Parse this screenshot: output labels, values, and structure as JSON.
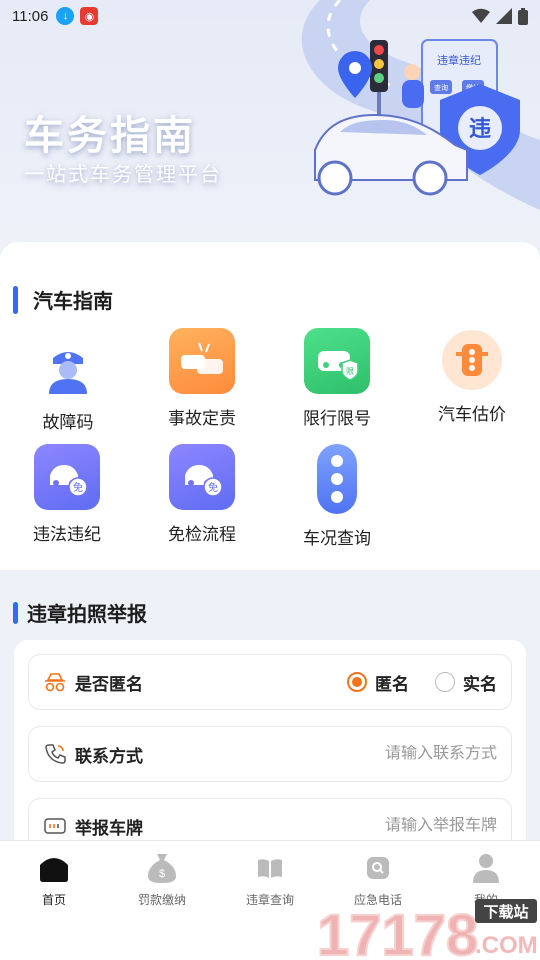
{
  "status": {
    "time": "11:06"
  },
  "hero": {
    "title": "车务指南",
    "subtitle": "一站式车务管理平台",
    "sign_text": "违章违纪",
    "shield_char": "违",
    "board_btn1": "查询",
    "board_btn2": "缴纳"
  },
  "guide": {
    "title": "汽车指南",
    "items": [
      {
        "label": "故障码",
        "icon": "police-icon"
      },
      {
        "label": "事故定责",
        "icon": "car-accident-icon"
      },
      {
        "label": "限行限号",
        "icon": "car-restriction-icon",
        "badge": "限"
      },
      {
        "label": "汽车估价",
        "icon": "traffic-light-icon"
      },
      {
        "label": "违法违纪",
        "icon": "car-free-icon",
        "badge": "免"
      },
      {
        "label": "免检流程",
        "icon": "car-free-icon",
        "badge": "免"
      },
      {
        "label": "车况查询",
        "icon": "traffic-light-icon"
      }
    ]
  },
  "report": {
    "title": "违章拍照举报",
    "anonymous": {
      "label": "是否匿名",
      "option_anon": "匿名",
      "option_real": "实名",
      "selected": "匿名"
    },
    "contact": {
      "label": "联系方式",
      "placeholder": "请输入联系方式"
    },
    "plate": {
      "label": "举报车牌",
      "placeholder": "请输入举报车牌"
    }
  },
  "tabs": [
    {
      "label": "首页",
      "icon": "home-icon",
      "active": true
    },
    {
      "label": "罚款缴纳",
      "icon": "money-bag-icon",
      "active": false
    },
    {
      "label": "违章查询",
      "icon": "book-icon",
      "active": false
    },
    {
      "label": "应急电话",
      "icon": "phone-search-icon",
      "active": false
    },
    {
      "label": "我的",
      "icon": "user-icon",
      "active": false
    }
  ],
  "watermark": {
    "text": "17178",
    "badge": "下载站",
    "suffix": ".COM"
  },
  "colors": {
    "accent": "#2f6cf6",
    "orange": "#f5731a",
    "green": "#3fd07a",
    "purple": "#6f74f5"
  }
}
